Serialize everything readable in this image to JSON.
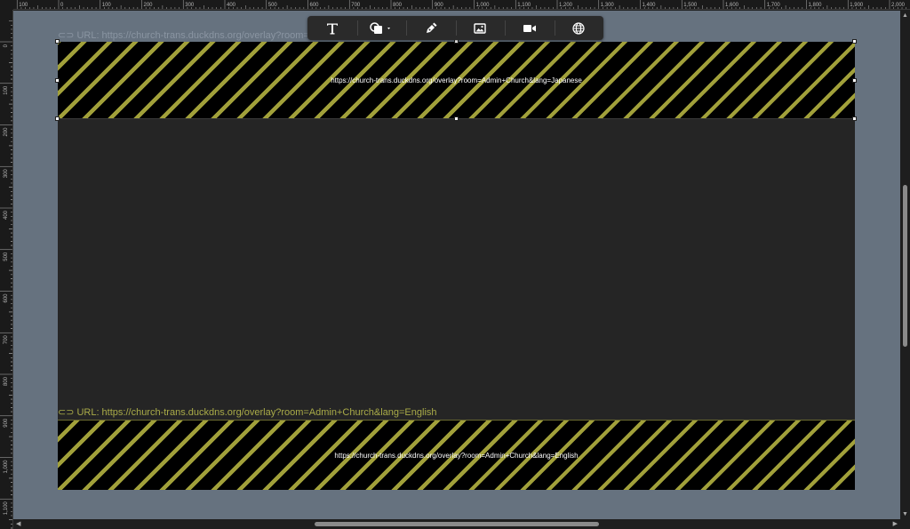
{
  "ruler": {
    "top_labels": [
      "100",
      "0",
      "100",
      "200",
      "300",
      "400",
      "500",
      "600",
      "700",
      "800",
      "900",
      "1,000",
      "1,100",
      "1,200",
      "1,300",
      "1,400",
      "1,500",
      "1,600",
      "1,700",
      "1,800",
      "1,900",
      "2,000"
    ],
    "left_labels": [
      "0",
      "100",
      "200",
      "300",
      "400",
      "500",
      "600",
      "700",
      "800",
      "900",
      "1,000",
      "1,100"
    ]
  },
  "toolbar": {
    "tools": [
      {
        "name": "text-tool",
        "icon": "text-icon"
      },
      {
        "name": "shape-tool",
        "icon": "shapes-icon"
      },
      {
        "name": "pen-tool",
        "icon": "pen-icon"
      },
      {
        "name": "image-tool",
        "icon": "image-icon"
      },
      {
        "name": "video-tool",
        "icon": "video-icon"
      },
      {
        "name": "web-tool",
        "icon": "globe-icon"
      }
    ]
  },
  "elements": {
    "top": {
      "caption": "URL: https://church-trans.duckdns.org/overlay?room=Admin",
      "url": "https://church-trans.duckdns.org/overlay?room=Admin+Church&lang=Japanese"
    },
    "bottom": {
      "caption": "URL: https://church-trans.duckdns.org/overlay?room=Admin+Church&lang=English",
      "url": "https://church-trans.duckdns.org/overlay?room=Admin+Church&lang=English"
    }
  },
  "colors": {
    "workarea": "#66727f",
    "artboard": "#252525",
    "stripe": "#a1a03a",
    "caption_active": "#a9ab48"
  }
}
